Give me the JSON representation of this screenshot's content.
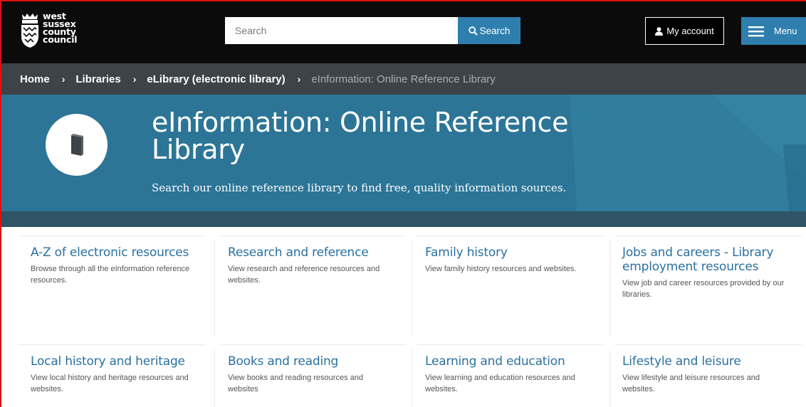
{
  "header": {
    "logo_lines": [
      "west",
      "sussex",
      "county",
      "council"
    ],
    "search_placeholder": "Search",
    "search_button": "Search",
    "account_button": "My account",
    "menu_button": "Menu"
  },
  "breadcrumb": {
    "items": [
      "Home",
      "Libraries",
      "eLibrary (electronic library)",
      "eInformation: Online Reference Library"
    ]
  },
  "hero": {
    "title": "eInformation: Online Reference Library",
    "subtitle": "Search our online reference library to find free, quality information sources.",
    "icon": "book-icon"
  },
  "cards": [
    {
      "title": "A-Z of electronic resources",
      "desc": "Browse through all the eInformation reference resources."
    },
    {
      "title": "Research and reference",
      "desc": "View research and reference resources and websites."
    },
    {
      "title": "Family history",
      "desc": "View family history resources and websites."
    },
    {
      "title": "Jobs and careers - Library employment resources",
      "desc": "View job and career resources provided by our libraries."
    },
    {
      "title": "Local history and heritage",
      "desc": "View local history and heritage resources and websites."
    },
    {
      "title": "Books and reading",
      "desc": "View books and reading resources and websites"
    },
    {
      "title": "Learning and education",
      "desc": "View learning and education resources and websites."
    },
    {
      "title": "Lifestyle and leisure",
      "desc": "View lifestyle and leisure resources and websites."
    }
  ],
  "colors": {
    "header_bg": "#0b0b0b",
    "accent_blue": "#2f7fae",
    "breadcrumb_bg": "#3d4346",
    "hero_bg": "#2c7597",
    "link_blue": "#2a70a0",
    "frame_red": "#dd1111"
  }
}
